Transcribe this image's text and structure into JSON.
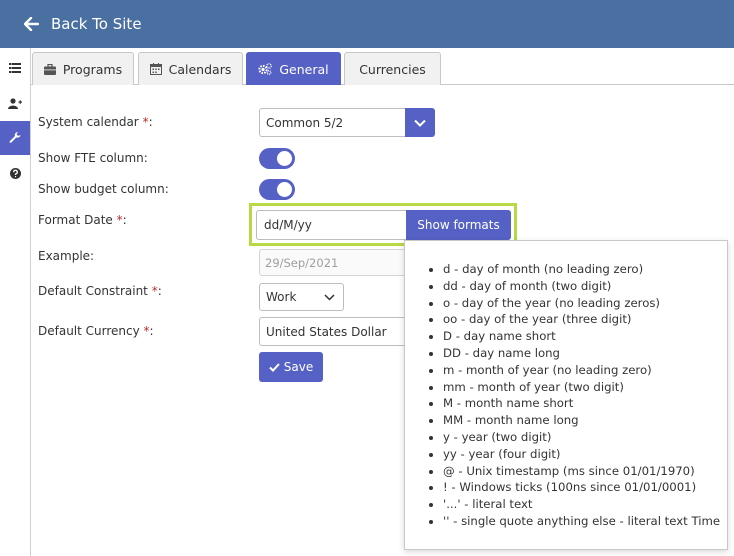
{
  "header": {
    "back_label": "Back To Site"
  },
  "sidebar": {
    "items": [
      "list-icon",
      "user-plus-icon",
      "wrench-icon",
      "question-icon"
    ]
  },
  "tabs": [
    {
      "label": "Programs",
      "icon": "briefcase-icon",
      "active": false
    },
    {
      "label": "Calendars",
      "icon": "calendar-icon",
      "active": false
    },
    {
      "label": "General",
      "icon": "gears-icon",
      "active": true
    },
    {
      "label": "Currencies",
      "icon": "",
      "active": false
    }
  ],
  "form": {
    "system_calendar": {
      "label": "System calendar ",
      "required": "*",
      "suffix": ":",
      "value": "Common 5/2"
    },
    "show_fte": {
      "label": "Show FTE column:",
      "checked": true
    },
    "show_budget": {
      "label": "Show budget column:",
      "checked": true
    },
    "format_date": {
      "label": "Format Date ",
      "required": "*",
      "suffix": ":",
      "value": "dd/M/yy",
      "button_label": "Show formats"
    },
    "example": {
      "label": "Example:",
      "value": "29/Sep/2021"
    },
    "default_constraint": {
      "label": "Default Constraint ",
      "required": "*",
      "suffix": ":",
      "value": "Work"
    },
    "default_currency": {
      "label": "Default Currency ",
      "required": "*",
      "suffix": ":",
      "value": "United States Dollar"
    },
    "save_label": "Save"
  },
  "formats_popup": {
    "items": [
      "d - day of month (no leading zero)",
      "dd - day of month (two digit)",
      "o - day of the year (no leading zeros)",
      "oo - day of the year (three digit)",
      "D - day name short",
      "DD - day name long",
      "m - month of year (no leading zero)",
      "mm - month of year (two digit)",
      "M - month name short",
      "MM - month name long",
      "y - year (two digit)",
      "yy - year (four digit)",
      "@ - Unix timestamp (ms since 01/01/1970)",
      "! - Windows ticks (100ns since 01/01/0001)",
      "'...' - literal text",
      "'' - single quote anything else - literal text Time"
    ]
  },
  "colors": {
    "header_bg": "#4a6fa1",
    "accent": "#5561c4",
    "highlight": "#b7d941",
    "required": "#c62828"
  }
}
